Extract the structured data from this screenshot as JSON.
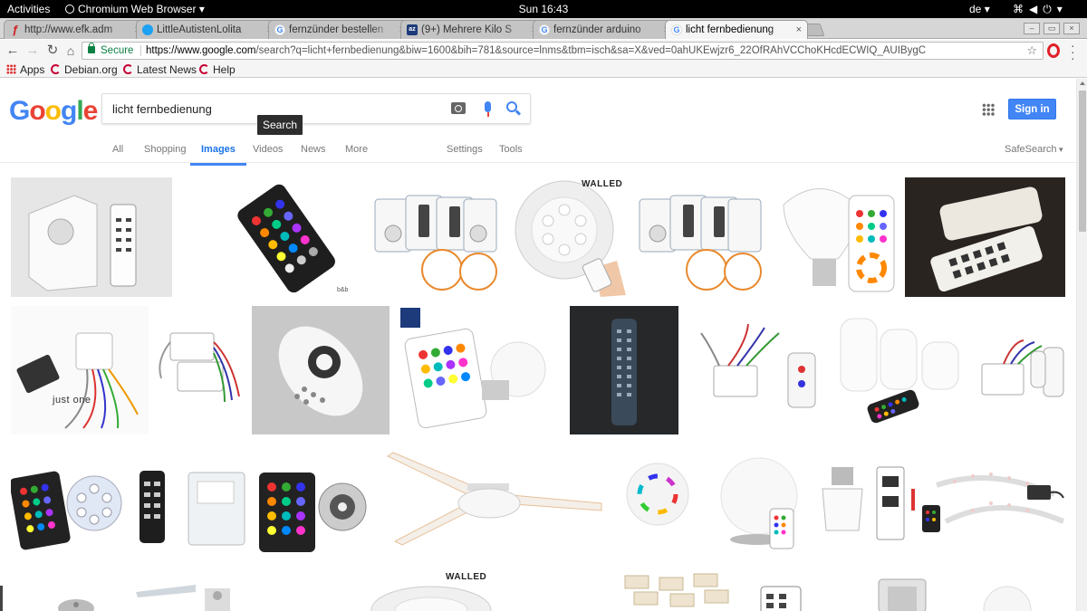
{
  "topbar": {
    "activities": "Activities",
    "app_name": "Chromium Web Browser",
    "clock": "Sun 16:43",
    "keyboard_lang": "de",
    "tray_icons": [
      "network-icon",
      "volume-icon",
      "power-icon"
    ]
  },
  "tabs": [
    {
      "title": "http://www.efk.adm",
      "icon": "efk-icon",
      "active": false
    },
    {
      "title": "LittleAutistenLolita",
      "icon": "twitter-icon",
      "active": false
    },
    {
      "title": "fernzünder bestellen",
      "icon": "google-icon",
      "active": false
    },
    {
      "title": "(9+) Mehrere Kilo S",
      "icon": "az-icon",
      "active": false
    },
    {
      "title": "fernzünder arduino",
      "icon": "google-icon",
      "active": false
    },
    {
      "title": "licht fernbedienung",
      "icon": "google-icon",
      "active": true
    }
  ],
  "toolbar": {
    "secure_label": "Secure",
    "url_host": "https://www.google.com",
    "url_path": "/search?q=licht+fernbedienung&biw=1600&bih=781&source=lnms&tbm=isch&sa=X&ved=0ahUKEwjzr6_22OfRAhVCChoKHcdECWIQ_AUIBygC"
  },
  "bookmarks": [
    {
      "label": "Apps",
      "icon": "apps-grid-icon"
    },
    {
      "label": "Debian.org",
      "icon": "debian-icon"
    },
    {
      "label": "Latest News",
      "icon": "debian-icon"
    },
    {
      "label": "Help",
      "icon": "debian-icon"
    }
  ],
  "google": {
    "logo": [
      "G",
      "o",
      "o",
      "g",
      "l",
      "e"
    ],
    "query": "licht fernbedienung",
    "search_tooltip": "Search",
    "signin_label": "Sign in"
  },
  "result_tabs": {
    "all": "All",
    "shopping": "Shopping",
    "images": "Images",
    "videos": "Videos",
    "news": "News",
    "more": "More",
    "settings": "Settings",
    "tools": "Tools",
    "safesearch": "SafeSearch",
    "active": "Images"
  },
  "image_captions": {
    "walled_1": "WALLED",
    "walled_2": "WALLED",
    "just_one": "just one"
  },
  "colors": {
    "google_blue": "#4285f4",
    "google_red": "#ea4335",
    "google_yellow": "#fbbc05",
    "google_green": "#34a853",
    "secure_green": "#0b8043"
  }
}
